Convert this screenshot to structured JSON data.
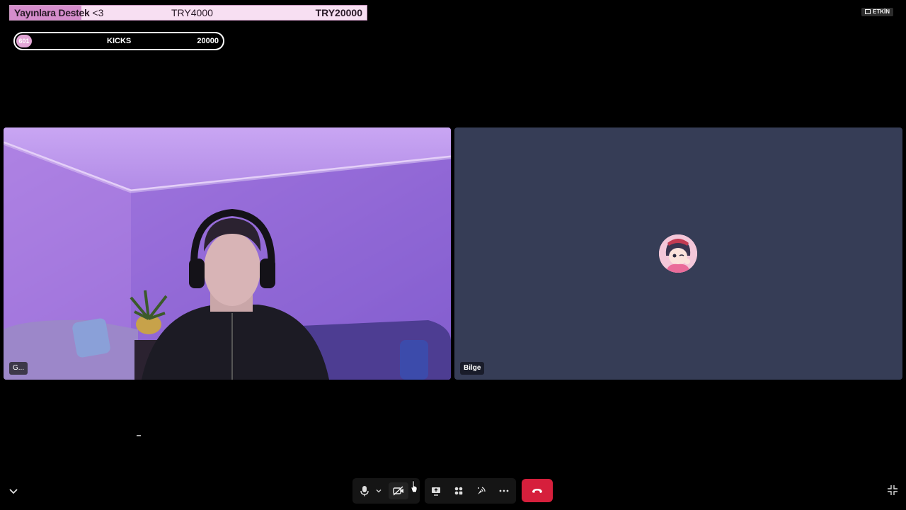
{
  "overlay": {
    "donation_goal": {
      "title": "Yayınlara Destek",
      "heart": "<3",
      "current": "TRY4000",
      "target": "TRY20000",
      "progress": 0.2,
      "fill_color": "#d58dcc",
      "track_color": "#f7dff2"
    },
    "kicks_goal": {
      "count": "601",
      "label": "KICKS",
      "target": "20000"
    }
  },
  "status_badge": {
    "label": "ETKİN"
  },
  "participants": [
    {
      "name": "G...",
      "video": "on"
    },
    {
      "name": "Bilge",
      "video": "off",
      "tile_color": "#363d56"
    }
  ],
  "toolbar": {
    "buttons": [
      {
        "icon": "microphone-icon"
      },
      {
        "icon": "chevron-down-icon"
      },
      {
        "icon": "camera-off-icon"
      },
      {
        "icon": "share-screen-icon"
      },
      {
        "icon": "activities-icon"
      },
      {
        "icon": "soundboard-icon"
      },
      {
        "icon": "more-icon"
      },
      {
        "icon": "hang-up-icon",
        "color": "#d61f3c"
      }
    ]
  }
}
